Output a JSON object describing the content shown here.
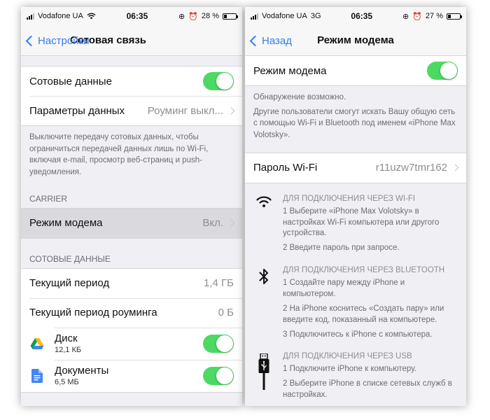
{
  "left": {
    "status": {
      "carrier": "Vodafone UA",
      "time": "06:35",
      "battery": "28 %",
      "battery_level": 0.28
    },
    "nav": {
      "back": "Настройки",
      "title": "Сотовая связь"
    },
    "cellular_data": {
      "label": "Сотовые данные",
      "toggle": true
    },
    "data_options": {
      "label": "Параметры данных",
      "value": "Роуминг выкл..."
    },
    "note": "Выключите передачу сотовых данных, чтобы ограничиться передачей данных лишь по Wi-Fi, включая e-mail, просмотр веб-страниц и push-уведомления.",
    "carrier_header": "CARRIER",
    "hotspot": {
      "label": "Режим модема",
      "value": "Вкл."
    },
    "data_header": "СОТОВЫЕ ДАННЫЕ",
    "current_period": {
      "label": "Текущий период",
      "value": "1,4 ГБ"
    },
    "roaming_period": {
      "label": "Текущий период роуминга",
      "value": "0 Б"
    },
    "apps": [
      {
        "name": "Диск",
        "size": "12,1 КБ",
        "icon": "google-drive-icon",
        "toggle": true
      },
      {
        "name": "Документы",
        "size": "6,5 МБ",
        "icon": "google-docs-icon",
        "toggle": true
      }
    ]
  },
  "right": {
    "status": {
      "carrier": "Vodafone UA",
      "network": "3G",
      "time": "06:35",
      "battery": "27 %",
      "battery_level": 0.27
    },
    "nav": {
      "back": "Назад",
      "title": "Режим модема"
    },
    "hotspot": {
      "label": "Режим модема",
      "toggle": true
    },
    "discovery_note": "Обнаружение возможно.",
    "discovery_detail": "Другие пользователи смогут искать Вашу общую сеть с помощью Wi-Fi и Bluetooth под именем «iPhone Max Volotsky».",
    "wifi_password": {
      "label": "Пароль Wi-Fi",
      "value": "r11uzw7tmr162"
    },
    "instructions": [
      {
        "icon": "wifi-icon",
        "title": "ДЛЯ ПОДКЛЮЧЕНИЯ ЧЕРЕЗ WI-FI",
        "steps": [
          "1 Выберите «iPhone Max Volotsky» в настройках Wi-Fi компьютера или другого устройства.",
          "2 Введите пароль при запросе."
        ]
      },
      {
        "icon": "bluetooth-icon",
        "title": "ДЛЯ ПОДКЛЮЧЕНИЯ ЧЕРЕЗ BLUETOOTH",
        "steps": [
          "1 Создайте пару между iPhone и компьютером.",
          "2 На iPhone коснитесь «Создать пару» или введите код, показанный на компьютере.",
          "3 Подключитесь к iPhone с компьютера."
        ]
      },
      {
        "icon": "usb-icon",
        "title": "ДЛЯ ПОДКЛЮЧЕНИЯ ЧЕРЕЗ USB",
        "steps": [
          "1 Подключите iPhone к компьютеру.",
          "2 Выберите iPhone в списке сетевых служб в настройках."
        ]
      }
    ]
  },
  "colors": {
    "accent": "#2f7cf6",
    "toggle_on": "#4cd964",
    "background": "#efeff4"
  }
}
